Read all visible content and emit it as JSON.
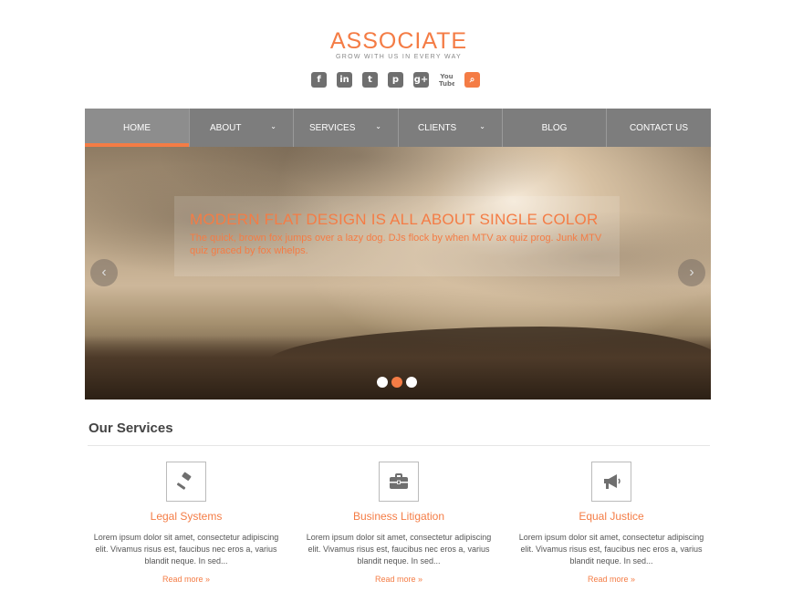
{
  "header": {
    "logo_title": "ASSOCIATE",
    "tagline": "GROW WITH US IN EVERY WAY"
  },
  "social": [
    {
      "icon": "facebook-icon",
      "glyph": "f"
    },
    {
      "icon": "linkedin-icon",
      "glyph": "in"
    },
    {
      "icon": "twitter-icon",
      "glyph": "t"
    },
    {
      "icon": "pinterest-icon",
      "glyph": "p"
    },
    {
      "icon": "google-plus-icon",
      "glyph": "g+"
    },
    {
      "icon": "youtube-icon",
      "glyph": "You Tube"
    },
    {
      "icon": "search-icon",
      "glyph": "⌕"
    }
  ],
  "nav": {
    "items": [
      {
        "label": "HOME",
        "dropdown": false,
        "active": true
      },
      {
        "label": "ABOUT",
        "dropdown": true,
        "active": false
      },
      {
        "label": "SERVICES",
        "dropdown": true,
        "active": false
      },
      {
        "label": "CLIENTS",
        "dropdown": true,
        "active": false
      },
      {
        "label": "BLOG",
        "dropdown": false,
        "active": false
      },
      {
        "label": "CONTACT US",
        "dropdown": false,
        "active": false
      }
    ]
  },
  "slider": {
    "title": "MODERN FLAT DESIGN IS ALL ABOUT SINGLE COLOR",
    "text": "The quick, brown fox jumps over a lazy dog. DJs flock by when MTV ax quiz prog. Junk MTV quiz graced by fox whelps.",
    "prev_glyph": "‹",
    "next_glyph": "›",
    "slide_count": 3,
    "active_slide": 2
  },
  "services": {
    "heading": "Our Services",
    "items": [
      {
        "title": "Legal Systems",
        "icon": "gavel-icon",
        "text": "Lorem ipsum dolor sit amet, consectetur adipiscing elit. Vivamus risus est, faucibus nec eros a, varius blandit neque. In sed...",
        "more": "Read more »"
      },
      {
        "title": "Business Litigation",
        "icon": "briefcase-icon",
        "text": "Lorem ipsum dolor sit amet, consectetur adipiscing elit. Vivamus risus est, faucibus nec eros a, varius blandit neque. In sed...",
        "more": "Read more »"
      },
      {
        "title": "Equal Justice",
        "icon": "megaphone-icon",
        "text": "Lorem ipsum dolor sit amet, consectetur adipiscing elit. Vivamus risus est, faucibus nec eros a, varius blandit neque. In sed...",
        "more": "Read more »"
      }
    ]
  },
  "colors": {
    "accent": "#f47c45",
    "nav_bg": "#7d7d7d",
    "icon_gray": "#6f6f6f"
  }
}
